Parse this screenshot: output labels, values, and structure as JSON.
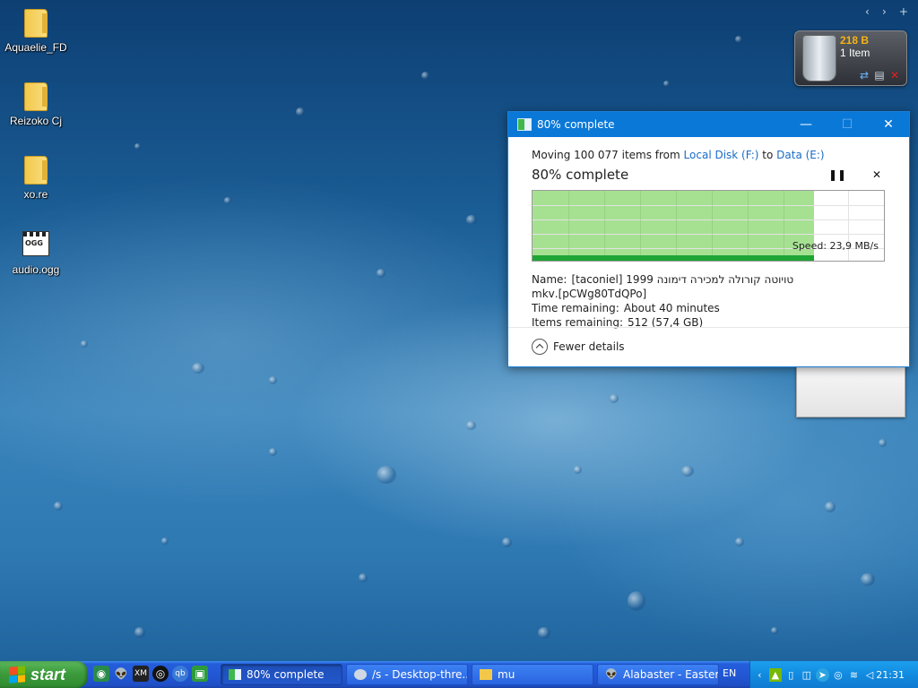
{
  "desktop": {
    "icons": [
      {
        "label": "Aquaelie_FD",
        "icon": "folder-icon"
      },
      {
        "label": "Reizoko Cj",
        "icon": "folder-icon"
      },
      {
        "label": "xo.re",
        "icon": "folder-icon"
      },
      {
        "label": "audio.ogg",
        "icon": "ogg-file-icon",
        "badge": "OGG"
      }
    ]
  },
  "recycle_bin": {
    "size": "218 B",
    "count": "1 Item"
  },
  "dialog": {
    "title": "80% complete",
    "moving_prefix": "Moving 100 077 items from",
    "source": "Local Disk (F:)",
    "to_word": "to",
    "destination": "Data (E:)",
    "percent_text": "80% complete",
    "progress_fraction": 0.8,
    "speed": "Speed: 23,9 MB/s",
    "name_label": "Name:",
    "name_value": "טויוטה קורולה למכירה דימונה 1999 [taconiel] [pCWg80TdQPo].mkv",
    "time_label": "Time remaining:",
    "time_value": "About 40 minutes",
    "items_label": "Items remaining:",
    "items_value": "512 (57,4 GB)",
    "fewer_details": "Fewer details"
  },
  "taskbar": {
    "start_label": "start",
    "buttons": [
      {
        "label": "80% complete",
        "active": true
      },
      {
        "label": "/s - Desktop-thre...",
        "active": false
      },
      {
        "label": "mu",
        "active": false
      },
      {
        "label": "Alabaster - Easter",
        "active": false
      }
    ],
    "language": "EN",
    "clock": "21:31"
  },
  "colors": {
    "accent": "#0a78d7",
    "progress_fill": "#a6e192",
    "progress_line": "#1fa535",
    "bin_size": "#f5b315"
  }
}
